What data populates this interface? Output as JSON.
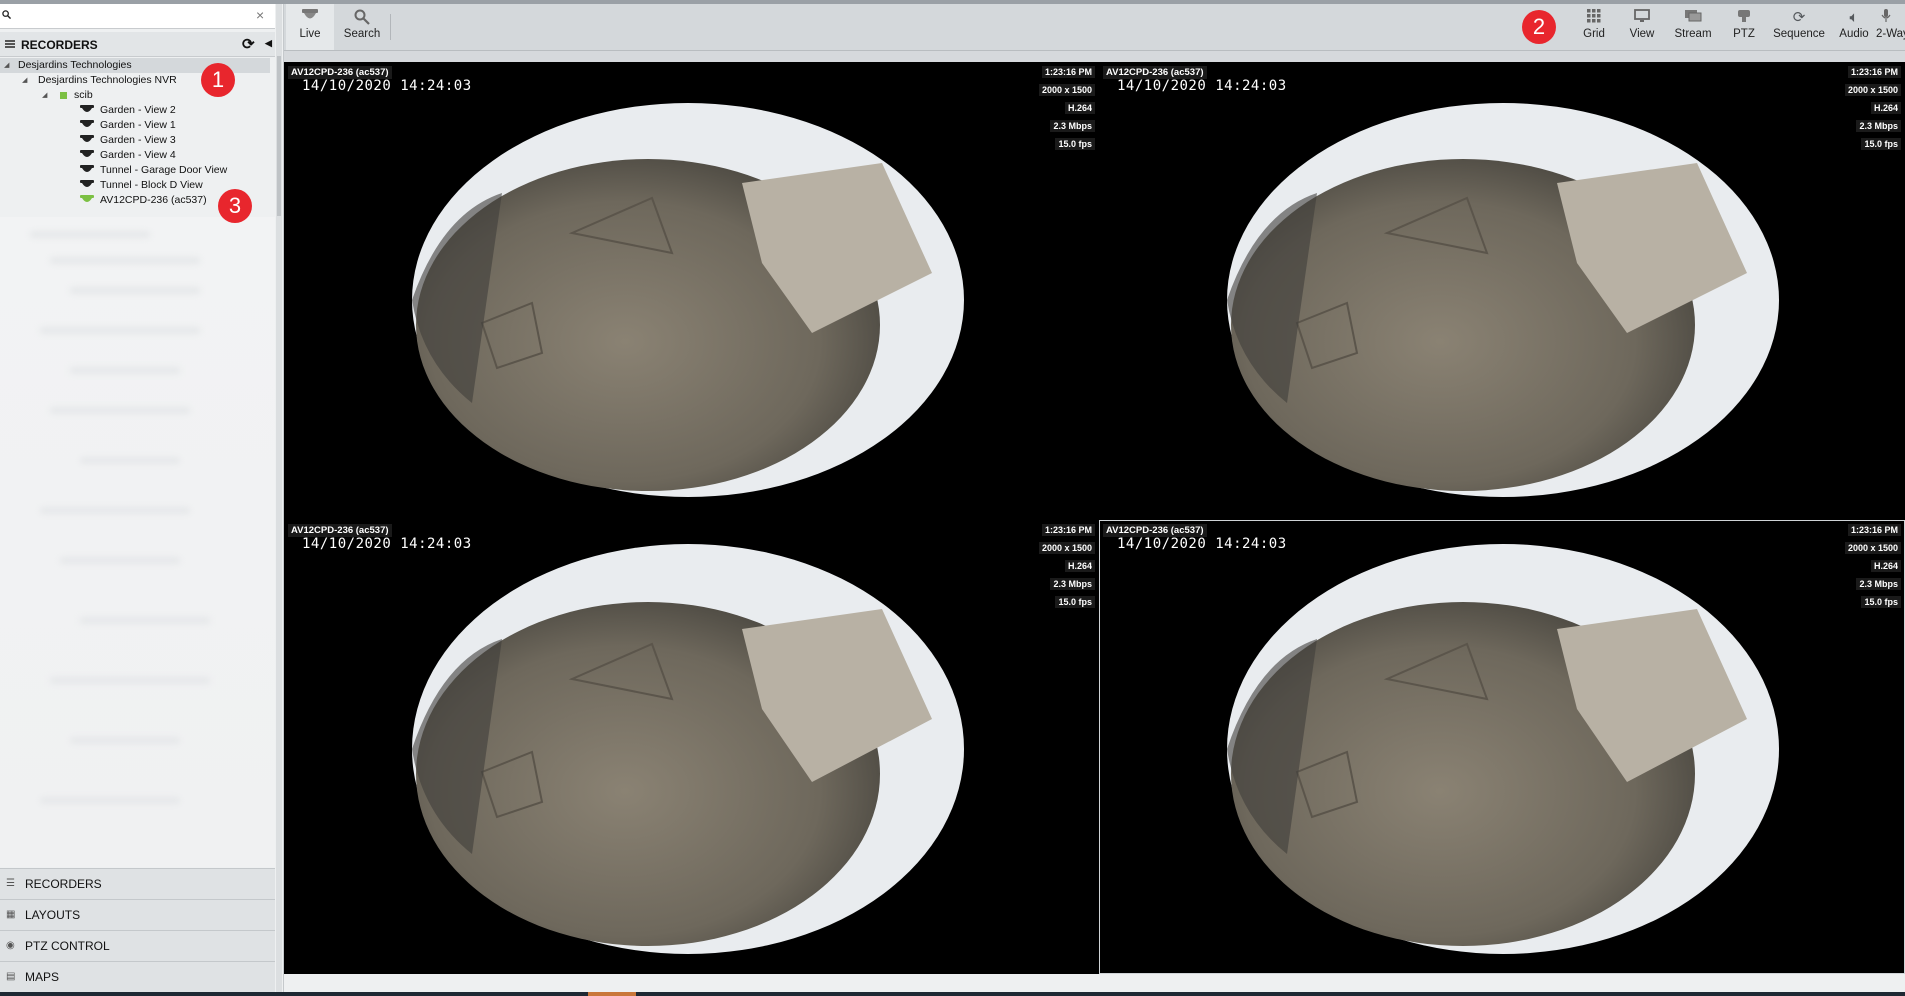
{
  "search": {
    "placeholder": "",
    "clear": "×"
  },
  "recorders_header": "RECORDERS",
  "tree": {
    "root": "Desjardins Technologies",
    "nvr": "Desjardins Technologies NVR",
    "group": "scib",
    "cameras": [
      "Garden - View 2",
      "Garden - View 1",
      "Garden - View 3",
      "Garden - View 4",
      "Tunnel - Garage Door View",
      "Tunnel - Block D View",
      "AV12CPD-236  (ac537)"
    ]
  },
  "sections": [
    "RECORDERS",
    "LAYOUTS",
    "PTZ CONTROL",
    "MAPS"
  ],
  "toolbar": {
    "left": [
      {
        "label": "Live",
        "icon": "live-icon"
      },
      {
        "label": "Search",
        "icon": "search-icon"
      }
    ],
    "right": [
      {
        "label": "Grid",
        "icon": "grid-icon"
      },
      {
        "label": "View",
        "icon": "monitor-icon"
      },
      {
        "label": "Stream",
        "icon": "stream-icon"
      },
      {
        "label": "PTZ",
        "icon": "ptz-icon"
      },
      {
        "label": "Sequence",
        "icon": "sequence-icon"
      },
      {
        "label": "Audio",
        "icon": "speaker-icon"
      },
      {
        "label": "2-Way",
        "icon": "microphone-icon"
      }
    ]
  },
  "tiles": [
    {
      "camera": "AV12CPD-236  (ac537)",
      "timestamp": "14/10/2020  14:24:03",
      "time": "1:23:16 PM",
      "resolution": "2000 x 1500",
      "codec": "H.264",
      "bitrate": "2.3 Mbps",
      "fps": "15.0 fps"
    },
    {
      "camera": "AV12CPD-236  (ac537)",
      "timestamp": "14/10/2020  14:24:03",
      "time": "1:23:16 PM",
      "resolution": "2000 x 1500",
      "codec": "H.264",
      "bitrate": "2.3 Mbps",
      "fps": "15.0 fps"
    },
    {
      "camera": "AV12CPD-236  (ac537)",
      "timestamp": "14/10/2020  14:24:03",
      "time": "1:23:16 PM",
      "resolution": "2000 x 1500",
      "codec": "H.264",
      "bitrate": "2.3 Mbps",
      "fps": "15.0 fps"
    },
    {
      "camera": "AV12CPD-236  (ac537)",
      "timestamp": "14/10/2020  14:24:03",
      "time": "1:23:16 PM",
      "resolution": "2000 x 1500",
      "codec": "H.264",
      "bitrate": "2.3 Mbps",
      "fps": "15.0 fps"
    }
  ],
  "annotations": [
    "1",
    "2",
    "3"
  ],
  "colors": {
    "badge": "#e8262d",
    "online_camera": "#7cc043",
    "offline_camera": "#222222",
    "video_bg": "#000000"
  }
}
